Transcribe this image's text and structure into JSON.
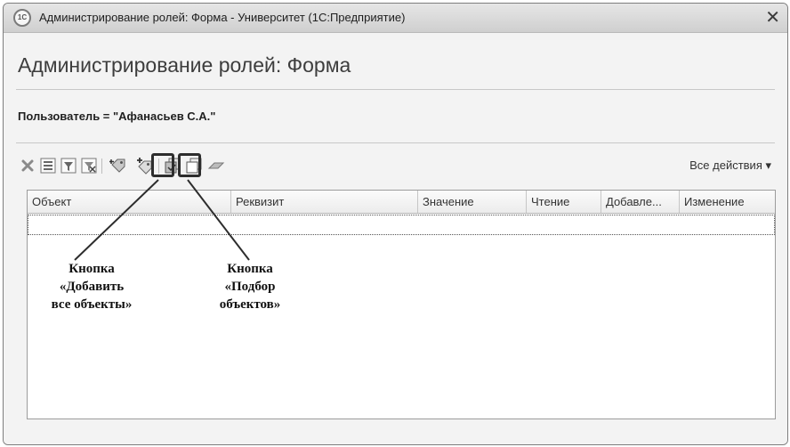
{
  "window": {
    "app_logo_text": "1C",
    "title": "Администрирование ролей: Форма - Университет  (1С:Предприятие)"
  },
  "form": {
    "title": "Администрирование ролей: Форма",
    "filter": "Пользователь = \"Афанасьев С.А.\""
  },
  "toolbar": {
    "icons": [
      "delete-icon",
      "list-icon",
      "filter-icon",
      "clear-filter-icon",
      "add-all-objects-icon",
      "pick-objects-icon",
      "copy-icon",
      "duplicate-icon",
      "eraser-icon"
    ],
    "all_actions": "Все действия ▾"
  },
  "table": {
    "columns": [
      "Объект",
      "Реквизит",
      "Значение",
      "Чтение",
      "Добавле...",
      "Изменение"
    ]
  },
  "annotations": {
    "add_all": "Кнопка\n«Добавить\nвсе объекты»",
    "pick": "Кнопка\n«Подбор\nобъектов»"
  }
}
